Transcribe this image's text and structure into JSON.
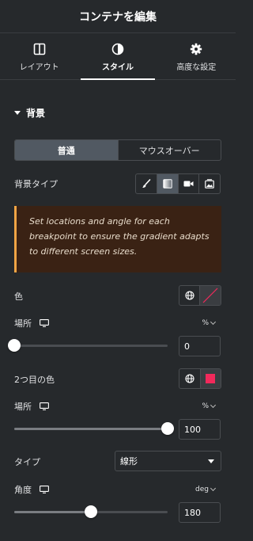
{
  "header": {
    "title": "コンテナを編集"
  },
  "tabs": [
    {
      "label": "レイアウト",
      "icon": "layout-icon"
    },
    {
      "label": "スタイル",
      "icon": "contrast-icon"
    },
    {
      "label": "高度な設定",
      "icon": "gear-icon"
    }
  ],
  "active_tab": "スタイル",
  "section": {
    "title": "背景"
  },
  "state_toggle": {
    "normal": "普通",
    "hover": "マウスオーバー",
    "active": "普通"
  },
  "background_type": {
    "label": "背景タイプ",
    "options": [
      "brush-icon",
      "gradient-icon",
      "video-icon",
      "slideshow-icon"
    ],
    "selected": "gradient-icon"
  },
  "notice": {
    "text": "Set locations and angle for each breakpoint to ensure the gradient adapts to different screen sizes."
  },
  "color1": {
    "label": "色",
    "value": "none"
  },
  "location1": {
    "label": "場所",
    "unit": "%",
    "value": "0",
    "level": 0
  },
  "color2": {
    "label": "2つ目の色",
    "value": "#f2295b"
  },
  "location2": {
    "label": "場所",
    "unit": "%",
    "value": "100",
    "level": 1
  },
  "gradient_type": {
    "label": "タイプ",
    "value": "線形"
  },
  "angle": {
    "label": "角度",
    "unit": "deg",
    "value": "180",
    "level": 0.5
  },
  "colors": {
    "accent": "#f2295b",
    "notice_border": "#f0a545",
    "notice_bg": "#3a2214"
  }
}
